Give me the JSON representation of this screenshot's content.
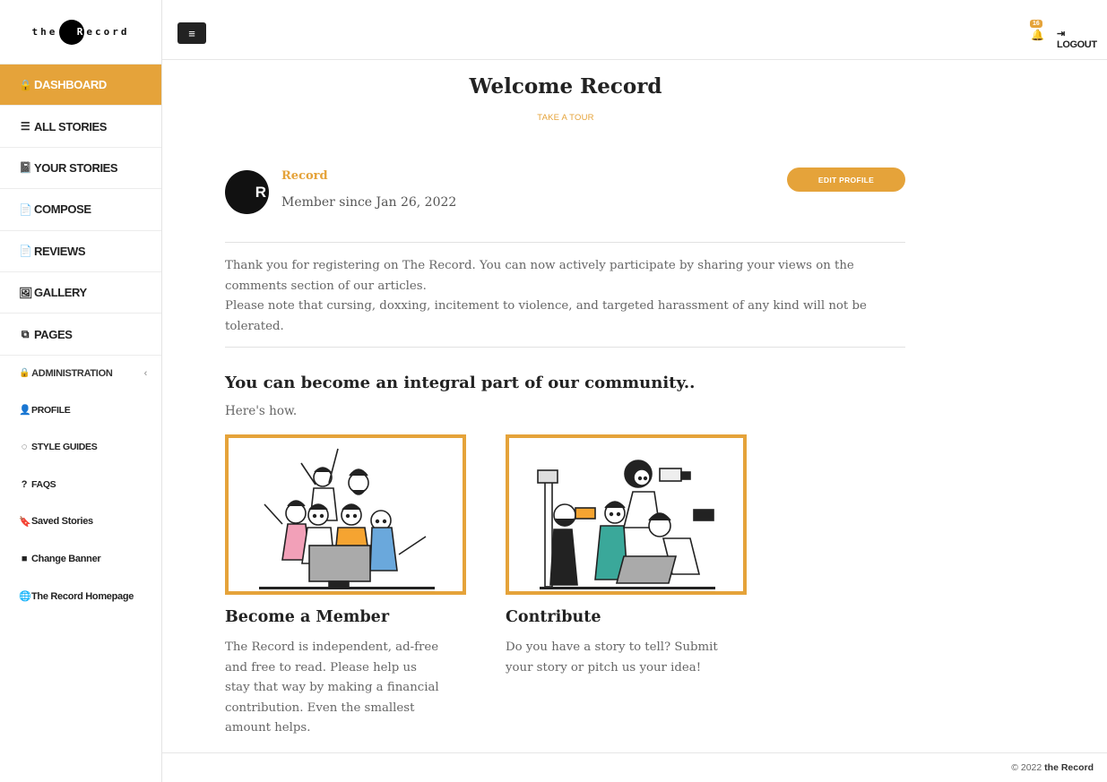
{
  "brand": {
    "logo_left": "the",
    "logo_dot": "R",
    "logo_right": "ecord"
  },
  "sidebar": {
    "items": [
      {
        "label": "DASHBOARD",
        "icon": "lock-icon",
        "glyph": "🔒"
      },
      {
        "label": "ALL STORIES",
        "icon": "list-icon",
        "glyph": "☰"
      },
      {
        "label": "YOUR STORIES",
        "icon": "book-icon",
        "glyph": "📓"
      },
      {
        "label": "COMPOSE",
        "icon": "file-icon",
        "glyph": "📄"
      },
      {
        "label": "REVIEWS",
        "icon": "file-icon",
        "glyph": "📄"
      },
      {
        "label": "GALLERY",
        "icon": "image-icon",
        "glyph": "🖼"
      },
      {
        "label": "PAGES",
        "icon": "copy-icon",
        "glyph": "⧉"
      }
    ],
    "admin": {
      "label": "ADMINISTRATION",
      "glyph": "🔒",
      "chevron": "‹"
    },
    "subitems": [
      {
        "label": "PROFILE",
        "glyph": "👤"
      },
      {
        "label": "STYLE GUIDES",
        "glyph": "◌"
      },
      {
        "label": "FAQS",
        "glyph": "?"
      },
      {
        "label": "Saved Stories",
        "glyph": "🔖"
      },
      {
        "label": "Change Banner",
        "glyph": "■"
      },
      {
        "label": "The Record Homepage",
        "glyph": "🌐"
      }
    ]
  },
  "topbar": {
    "menu_glyph": "≡",
    "notification_count": "16",
    "bell_glyph": "🔔",
    "logout_label": "LOGOUT",
    "logout_glyph": "⇥"
  },
  "main": {
    "welcome_title": "Welcome Record",
    "tour_label": "TAKE A TOUR",
    "profile": {
      "avatar_letter": "R",
      "name": "Record",
      "member_since": "Member since Jan 26, 2022",
      "edit_label": "EDIT PROFILE"
    },
    "notice_line1": "Thank you for registering on The Record. You can now actively participate by sharing your views on the comments section of our articles.",
    "notice_line2": "Please note that cursing, doxxing, incitement to violence, and targeted harassment of any kind will not be tolerated.",
    "community_heading": "You can become an integral part of our community..",
    "heres_how": "Here's how.",
    "cards": [
      {
        "title": "Become a Member",
        "text": "The Record is independent, ad-free and free to read. Please help us stay that way by making a financial contribution. Even the smallest amount helps."
      },
      {
        "title": "Contribute",
        "text": "Do you have a story to tell? Submit your story or pitch us your idea!"
      }
    ]
  },
  "footer": {
    "copyright": "© 2022",
    "brand": "the Record"
  },
  "colors": {
    "accent": "#e5a33a",
    "dark": "#222222"
  }
}
